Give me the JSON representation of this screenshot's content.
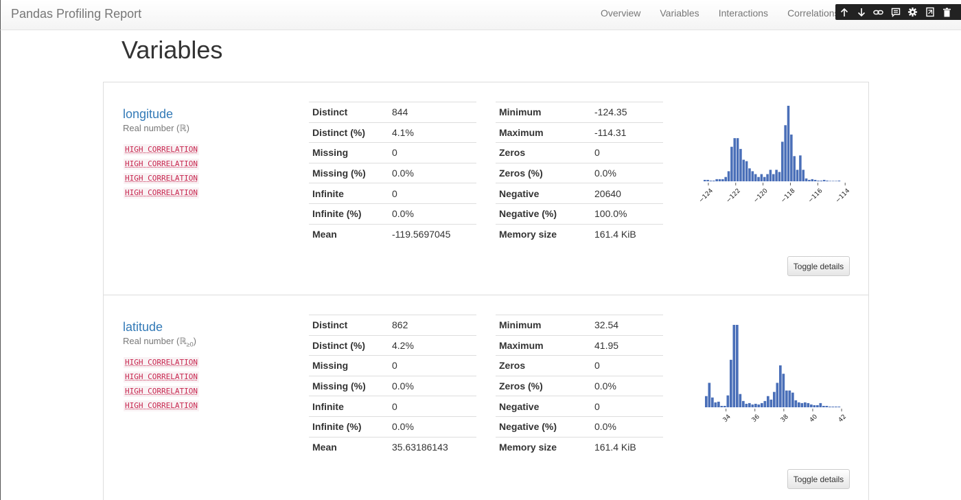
{
  "navbar": {
    "brand": "Pandas Profiling Report",
    "links": [
      "Overview",
      "Variables",
      "Interactions",
      "Correlations"
    ]
  },
  "toolbar_icons": [
    "arrow-up-icon",
    "arrow-down-icon",
    "link-icon",
    "comment-icon",
    "gear-icon",
    "notebook-icon",
    "trash-icon"
  ],
  "page": {
    "title": "Variables"
  },
  "variables": [
    {
      "name": "longitude",
      "type_prefix": "Real number (",
      "type_symbol": "ℝ",
      "type_sub": "",
      "type_suffix": ")",
      "alerts": [
        "HIGH CORRELATION",
        "HIGH CORRELATION",
        "HIGH CORRELATION",
        "HIGH CORRELATION"
      ],
      "stats_left": [
        [
          "Distinct",
          "844"
        ],
        [
          "Distinct (%)",
          "4.1%"
        ],
        [
          "Missing",
          "0"
        ],
        [
          "Missing (%)",
          "0.0%"
        ],
        [
          "Infinite",
          "0"
        ],
        [
          "Infinite (%)",
          "0.0%"
        ],
        [
          "Mean",
          "-119.5697045"
        ]
      ],
      "stats_right": [
        [
          "Minimum",
          "-124.35"
        ],
        [
          "Maximum",
          "-114.31"
        ],
        [
          "Zeros",
          "0"
        ],
        [
          "Zeros (%)",
          "0.0%"
        ],
        [
          "Negative",
          "20640"
        ],
        [
          "Negative (%)",
          "100.0%"
        ],
        [
          "Memory size",
          "161.4 KiB"
        ]
      ],
      "toggle_label": "Toggle details"
    },
    {
      "name": "latitude",
      "type_prefix": "Real number (",
      "type_symbol": "ℝ",
      "type_sub": "≥0",
      "type_suffix": ")",
      "alerts": [
        "HIGH CORRELATION",
        "HIGH CORRELATION",
        "HIGH CORRELATION",
        "HIGH CORRELATION"
      ],
      "stats_left": [
        [
          "Distinct",
          "862"
        ],
        [
          "Distinct (%)",
          "4.2%"
        ],
        [
          "Missing",
          "0"
        ],
        [
          "Missing (%)",
          "0.0%"
        ],
        [
          "Infinite",
          "0"
        ],
        [
          "Infinite (%)",
          "0.0%"
        ],
        [
          "Mean",
          "35.63186143"
        ]
      ],
      "stats_right": [
        [
          "Minimum",
          "32.54"
        ],
        [
          "Maximum",
          "41.95"
        ],
        [
          "Zeros",
          "0"
        ],
        [
          "Zeros (%)",
          "0.0%"
        ],
        [
          "Negative",
          "0"
        ],
        [
          "Negative (%)",
          "0.0%"
        ],
        [
          "Memory size",
          "161.4 KiB"
        ]
      ],
      "toggle_label": "Toggle details"
    }
  ],
  "chart_data": [
    {
      "type": "bar",
      "xlim": [
        -124.35,
        -114.31
      ],
      "ticks": [
        -124,
        -122,
        -120,
        -118,
        -116,
        -114
      ],
      "tick_labels": [
        "−124",
        "−122",
        "−120",
        "−118",
        "−116",
        "−114"
      ],
      "bar_color": "#4a6fb8",
      "values": [
        2,
        2,
        1,
        1,
        3,
        3,
        3,
        6,
        14,
        48,
        60,
        60,
        45,
        30,
        28,
        18,
        14,
        10,
        6,
        10,
        6,
        10,
        16,
        10,
        16,
        13,
        55,
        78,
        105,
        65,
        35,
        16,
        36,
        16,
        4,
        2,
        3,
        2,
        1,
        1,
        2,
        1,
        0,
        0,
        0,
        1
      ]
    },
    {
      "type": "bar",
      "xlim": [
        32.54,
        41.95
      ],
      "ticks": [
        34,
        36,
        38,
        40,
        42
      ],
      "tick_labels": [
        "34",
        "36",
        "38",
        "40",
        "42"
      ],
      "bar_color": "#4a6fb8",
      "values": [
        16,
        35,
        14,
        7,
        8,
        2,
        2,
        17,
        68,
        118,
        118,
        19,
        9,
        5,
        6,
        4,
        5,
        4,
        6,
        9,
        16,
        11,
        22,
        35,
        60,
        48,
        24,
        24,
        21,
        10,
        7,
        6,
        7,
        6,
        4,
        3,
        3,
        6,
        2,
        2,
        1,
        1,
        1,
        1
      ]
    }
  ]
}
